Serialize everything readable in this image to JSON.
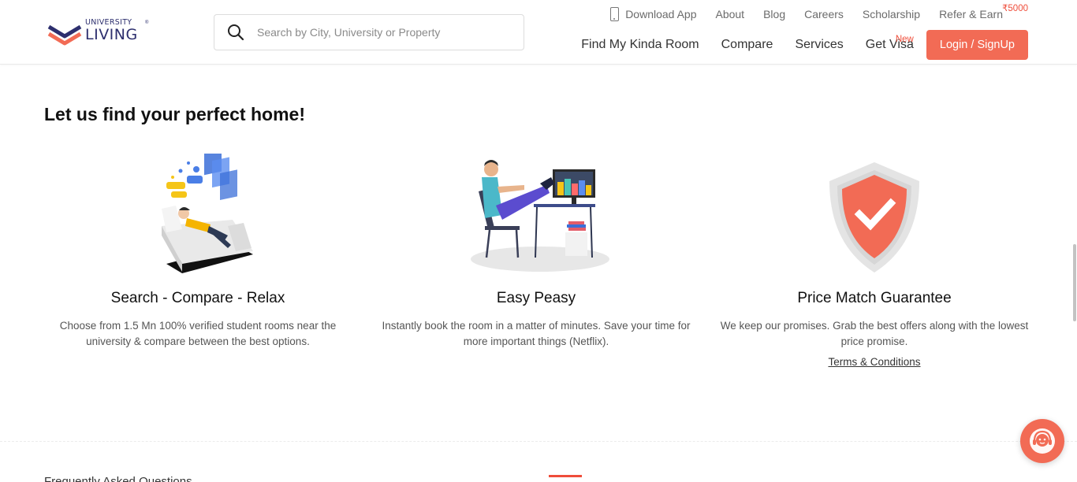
{
  "brand": {
    "line1": "UNIVERSITY",
    "line2": "LIVING",
    "reg": "®"
  },
  "search": {
    "placeholder": "Search by City, University or Property",
    "value": ""
  },
  "top_links": {
    "download_app": "Download App",
    "about": "About",
    "blog": "Blog",
    "careers": "Careers",
    "scholarship": "Scholarship",
    "refer_earn": "Refer & Earn",
    "refer_badge": "₹5000"
  },
  "main_nav": {
    "find_room": "Find My Kinda Room",
    "compare": "Compare",
    "services": "Services",
    "get_visa": "Get Visa",
    "get_visa_badge": "New",
    "login": "Login / SignUp"
  },
  "section": {
    "title": "Let us find your perfect home!"
  },
  "features": [
    {
      "title": "Search - Compare - Relax",
      "desc": "Choose from 1.5 Mn 100% verified student rooms near the university & compare between the best options.",
      "icon": "relax-illustration"
    },
    {
      "title": "Easy Peasy",
      "desc": "Instantly book the room in a matter of minutes. Save your time for more important things (Netflix).",
      "icon": "booking-illustration"
    },
    {
      "title": "Price Match Guarantee",
      "desc": "We keep our promises. Grab the best offers along with the lowest price promise.",
      "link": "Terms & Conditions",
      "icon": "shield-check-icon"
    }
  ],
  "faq": {
    "title_partial": "Frequently Asked Questions"
  },
  "colors": {
    "accent": "#f26b55",
    "brand_navy": "#2d2f6e",
    "badge_red": "#ef4d3a"
  }
}
